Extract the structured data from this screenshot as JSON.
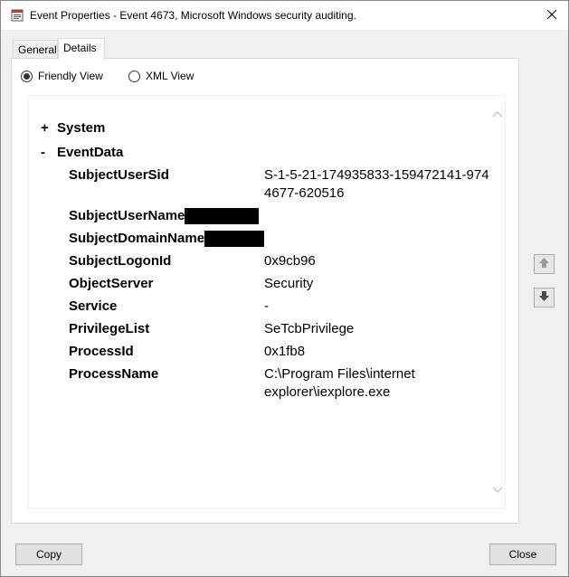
{
  "window": {
    "title": "Event Properties - Event 4673, Microsoft Windows security auditing."
  },
  "tabs": [
    {
      "label": "General"
    },
    {
      "label": "Details"
    }
  ],
  "view_options": {
    "friendly": "Friendly View",
    "xml": "XML View",
    "selected": "Friendly View"
  },
  "tree": {
    "system": {
      "toggle": "+",
      "label": "System"
    },
    "eventdata": {
      "toggle": "-",
      "label": "EventData"
    },
    "fields": [
      {
        "key": "SubjectUserSid",
        "value": "S-1-5-21-174935833-159472141-974474677-620516"
      },
      {
        "key": "SubjectUserName",
        "value": ""
      },
      {
        "key": "SubjectDomainName",
        "value": ""
      },
      {
        "key": "SubjectLogonId",
        "value": "0x9cb96"
      },
      {
        "key": "ObjectServer",
        "value": "Security"
      },
      {
        "key": "Service",
        "value": "-"
      },
      {
        "key": "PrivilegeList",
        "value": "SeTcbPrivilege"
      },
      {
        "key": "ProcessId",
        "value": "0x1fb8"
      },
      {
        "key": "ProcessName",
        "value": "C:\\Program Files\\internet explorer\\iexplore.exe"
      }
    ]
  },
  "buttons": {
    "copy": "Copy",
    "close": "Close"
  },
  "icons": {
    "app": "event-viewer-icon",
    "close": "close-icon",
    "scroll_up": "chevron-up-icon",
    "scroll_down": "chevron-down-icon",
    "prev": "arrow-up-icon",
    "next": "arrow-down-icon"
  }
}
